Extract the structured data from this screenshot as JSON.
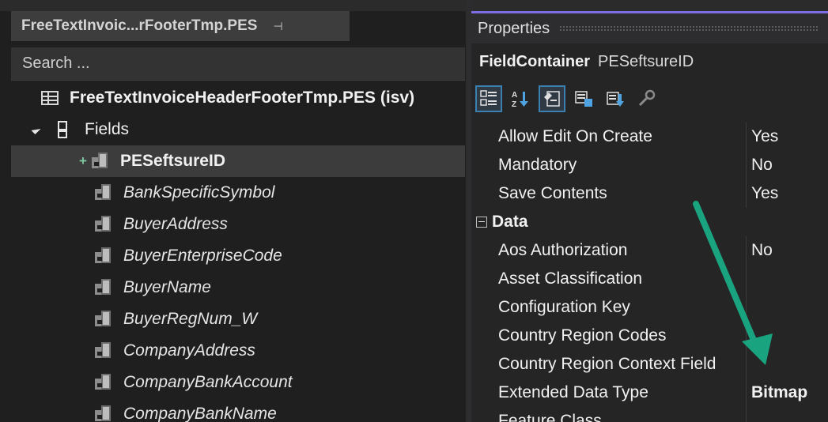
{
  "explorer": {
    "tab_title": "FreeTextInvoic...rFooterTmp.PES",
    "pin_glyph": "⊣",
    "search_placeholder": "Search ...",
    "root_label": "FreeTextInvoiceHeaderFooterTmp.PES (isv)",
    "fields_label": "Fields",
    "selected_plus": "+",
    "fields": [
      {
        "name": "PESeftsureID",
        "selected": true
      },
      {
        "name": "BankSpecificSymbol"
      },
      {
        "name": "BuyerAddress"
      },
      {
        "name": "BuyerEnterpriseCode"
      },
      {
        "name": "BuyerName"
      },
      {
        "name": "BuyerRegNum_W"
      },
      {
        "name": "CompanyAddress"
      },
      {
        "name": "CompanyBankAccount"
      },
      {
        "name": "CompanyBankName"
      }
    ]
  },
  "properties": {
    "title": "Properties",
    "object_type": "FieldContainer",
    "object_name": "PESeftsureID",
    "toolbar_icons": [
      "categorized-icon",
      "alphabetical-icon",
      "property-pages-icon",
      "events-icon",
      "event-handlers-icon",
      "wrench-icon"
    ],
    "rows": [
      {
        "name": "Allow Edit On Create",
        "value": "Yes"
      },
      {
        "name": "Mandatory",
        "value": "No"
      },
      {
        "name": "Save Contents",
        "value": "Yes"
      }
    ],
    "category": "Data",
    "data_rows": [
      {
        "name": "Aos Authorization",
        "value": "No"
      },
      {
        "name": "Asset Classification",
        "value": ""
      },
      {
        "name": "Configuration Key",
        "value": ""
      },
      {
        "name": "Country Region Codes",
        "value": ""
      },
      {
        "name": "Country Region Context Field",
        "value": ""
      },
      {
        "name": "Extended Data Type",
        "value": "Bitmap"
      },
      {
        "name": "Feature Class",
        "value": ""
      }
    ]
  },
  "annotation": {
    "arrow_color": "#1aa37f"
  }
}
